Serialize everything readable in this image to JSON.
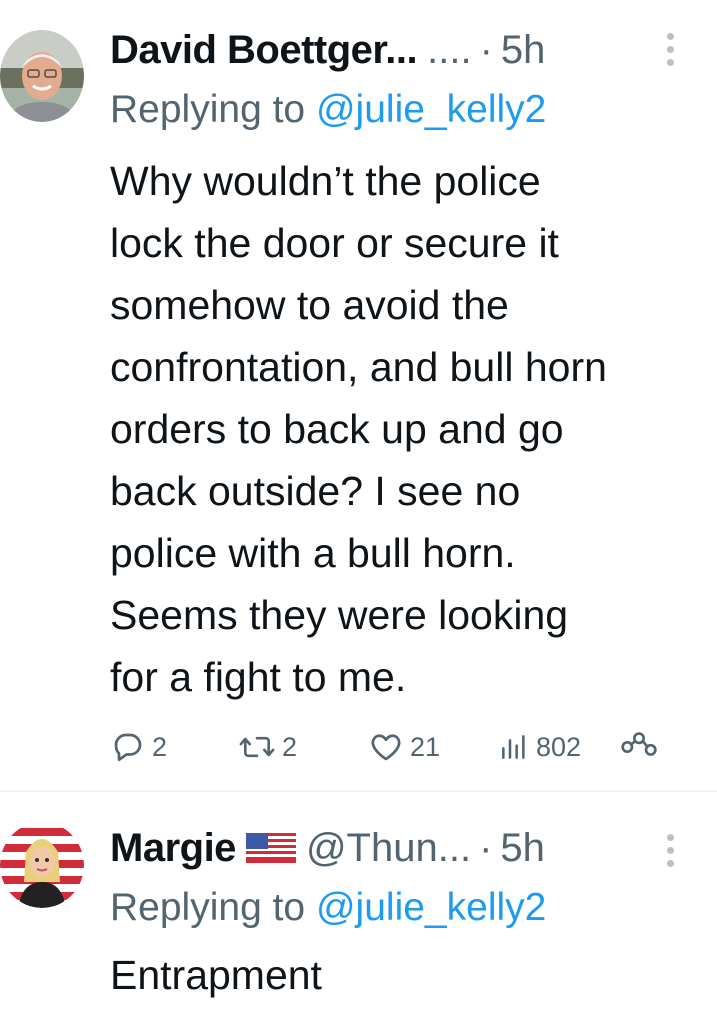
{
  "tweets": [
    {
      "author_name": "David Boettger...",
      "author_handle": "....",
      "separator": "·",
      "time": "5h",
      "replying_prefix": "Replying to",
      "replying_to": "@julie_kelly2",
      "body_lines": [
        "Why wouldn’t the police",
        "lock the door or secure it",
        "somehow to avoid the",
        "confrontation, and bull horn",
        "orders to back up and go",
        "back outside? I see no",
        "police with a bull horn.",
        "Seems they were looking",
        "for a fight to me."
      ],
      "stats": {
        "replies": "2",
        "retweets": "2",
        "likes": "21",
        "views": "802"
      },
      "icons": [
        "reply-icon",
        "retweet-icon",
        "like-icon",
        "views-icon",
        "share-icon",
        "more-options-icon"
      ]
    },
    {
      "author_name": "Margie",
      "author_flag": "us-flag-icon",
      "author_handle": "@Thun...",
      "separator": "·",
      "time": "5h",
      "replying_prefix": "Replying to",
      "replying_to": "@julie_kelly2",
      "body": "Entrapment"
    }
  ],
  "colors": {
    "text": "#0f1419",
    "secondary": "#536471",
    "link": "#1d9bf0",
    "divider": "#eff3f4"
  }
}
